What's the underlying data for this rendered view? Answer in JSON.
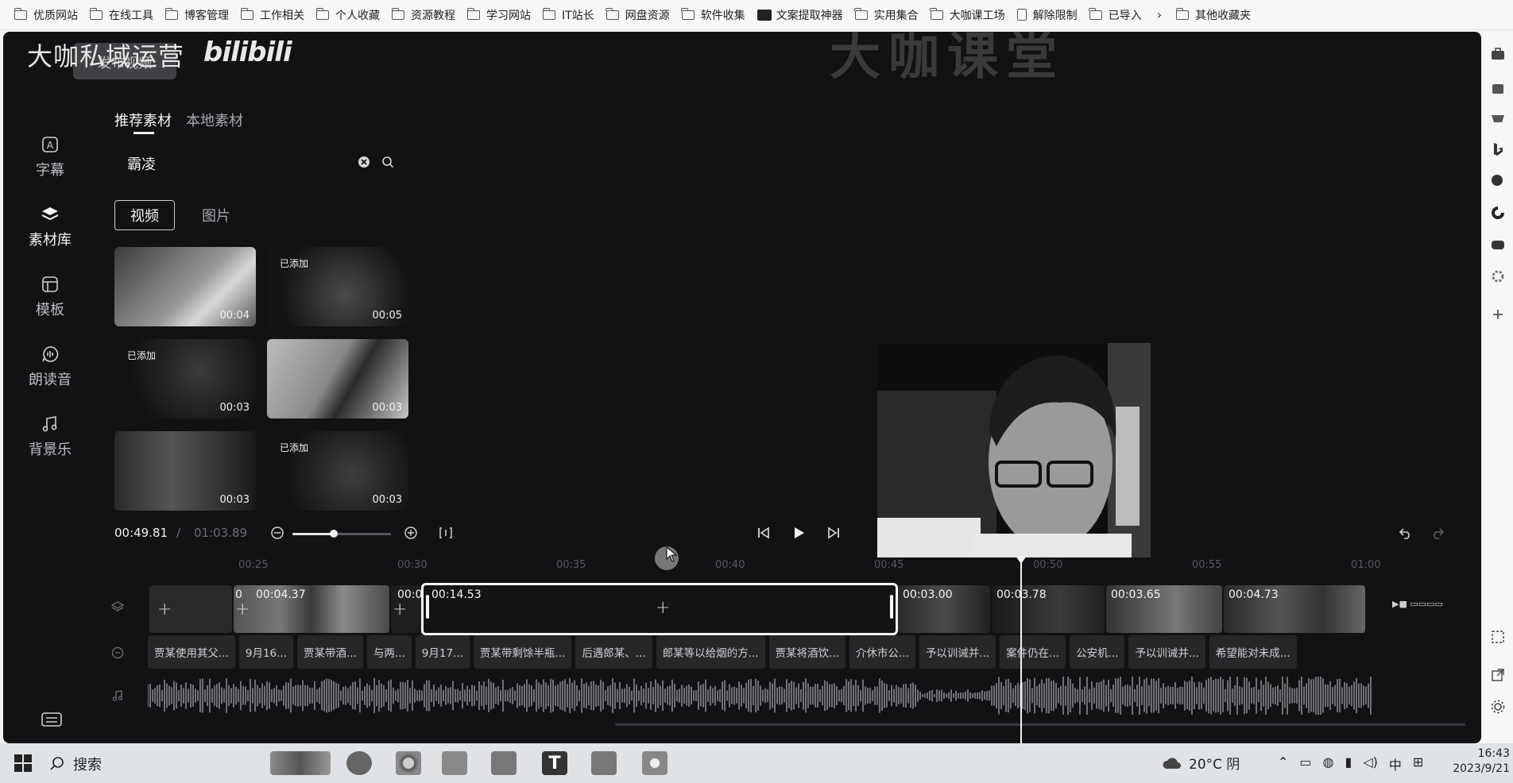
{
  "bookmarks": [
    {
      "label": "优质网站",
      "type": "folder"
    },
    {
      "label": "在线工具",
      "type": "folder"
    },
    {
      "label": "博客管理",
      "type": "folder"
    },
    {
      "label": "工作相关",
      "type": "folder"
    },
    {
      "label": "个人收藏",
      "type": "folder"
    },
    {
      "label": "资源教程",
      "type": "folder"
    },
    {
      "label": "学习网站",
      "type": "folder"
    },
    {
      "label": "IT站长",
      "type": "folder"
    },
    {
      "label": "网盘资源",
      "type": "folder"
    },
    {
      "label": "软件收集",
      "type": "folder"
    },
    {
      "label": "文案提取神器",
      "type": "site"
    },
    {
      "label": "实用集合",
      "type": "folder"
    },
    {
      "label": "大咖课工场",
      "type": "folder"
    },
    {
      "label": "解除限制",
      "type": "page"
    },
    {
      "label": "已导入",
      "type": "folder"
    }
  ],
  "bookmarks_other": "其他收藏夹",
  "app": {
    "brand": "大咖私域运营",
    "bili_logo": "bilibili",
    "publish_button": "发布视频",
    "ghost_overlay": "大咖课堂"
  },
  "sidebar": [
    {
      "label": "字幕",
      "icon": "subtitle-icon",
      "active": false
    },
    {
      "label": "素材库",
      "icon": "layers-icon",
      "active": true
    },
    {
      "label": "模板",
      "icon": "template-icon",
      "active": false
    },
    {
      "label": "朗读音",
      "icon": "voice-icon",
      "active": false
    },
    {
      "label": "背景乐",
      "icon": "music-icon",
      "active": false
    }
  ],
  "material_tabs": [
    "推荐素材",
    "本地素材"
  ],
  "search": {
    "value": "霸凌"
  },
  "type_tabs": [
    "视频",
    "图片"
  ],
  "thumbnails": [
    {
      "duration": "00:04",
      "added": ""
    },
    {
      "duration": "00:05",
      "added": "已添加"
    },
    {
      "duration": "00:03",
      "added": "已添加"
    },
    {
      "duration": "00:03",
      "added": ""
    },
    {
      "duration": "00:03",
      "added": ""
    },
    {
      "duration": "00:03",
      "added": "已添加"
    }
  ],
  "player": {
    "current_time": "00:49.81",
    "separator": "/",
    "total_time": "01:03.89",
    "zoom_level": 0.42
  },
  "ruler_ticks": [
    "00:25",
    "00:30",
    "00:35",
    "00:40",
    "00:45",
    "00:50",
    "00:55",
    "01:00"
  ],
  "clips": [
    {
      "label": "0"
    },
    {
      "label": "00:04.37"
    },
    {
      "label": "00:0"
    },
    {
      "label": "00:14.53",
      "selected": true
    },
    {
      "label": "00:03.00"
    },
    {
      "label": "00:03.78"
    },
    {
      "label": "00:03.65"
    },
    {
      "label": "00:04.73"
    }
  ],
  "subtitles": [
    "贾某使用其父...",
    "9月16...",
    "贾某带酒...",
    "与两...",
    "9月17...",
    "贾某带剩馀半瓶...",
    "后遇郎某、...",
    "郎某等以给烟的方...",
    "贾某将酒饮...",
    "介休市公...",
    "予以训诫并...",
    "案件仍在...",
    "公安机...",
    "予以训诫并...",
    "希望能对未成..."
  ],
  "taskbar": {
    "search_label": "搜索",
    "weather": "20°C 阴",
    "ime": "中",
    "time": "16:43",
    "date": "2023/9/21"
  },
  "colors": {
    "app_bg": "#121214",
    "accent": "#f4f4f4"
  }
}
